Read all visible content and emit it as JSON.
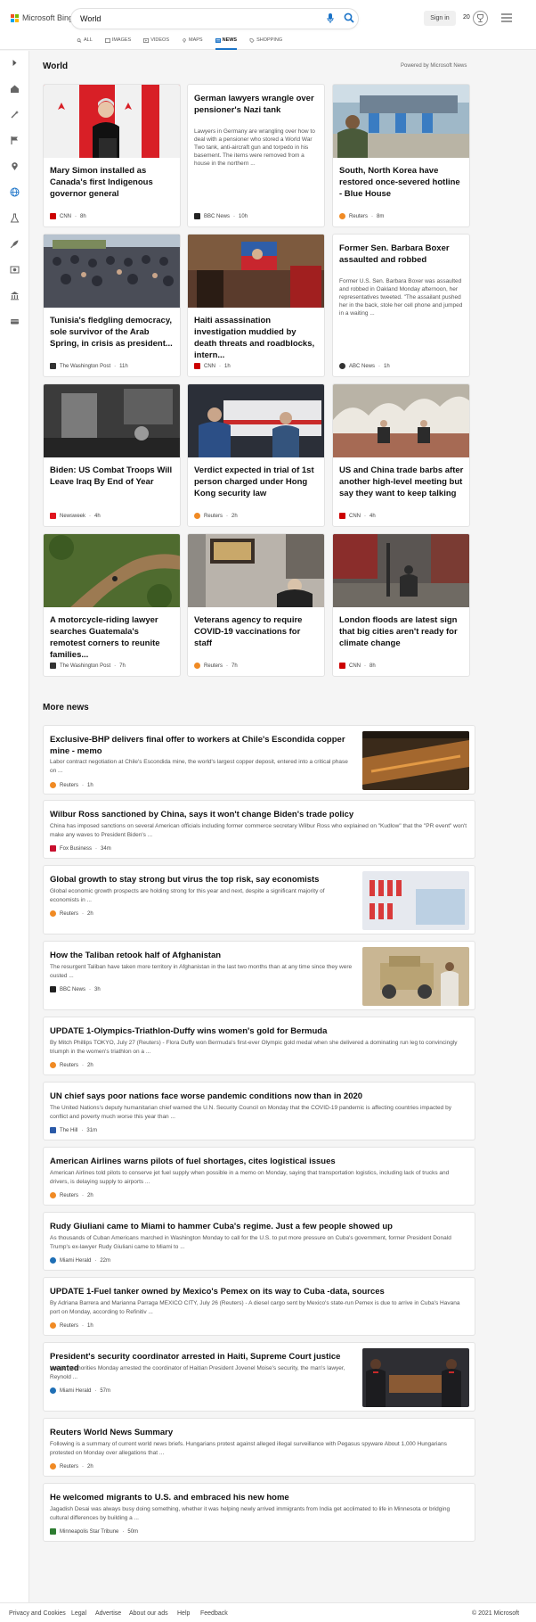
{
  "header": {
    "logo_text": "Microsoft Bing",
    "search_value": "World",
    "signin": "Sign in",
    "rewards_count": "20"
  },
  "tabs": [
    {
      "label": "ALL",
      "icon": "search-icon"
    },
    {
      "label": "IMAGES",
      "icon": "image-icon"
    },
    {
      "label": "VIDEOS",
      "icon": "video-icon"
    },
    {
      "label": "MAPS",
      "icon": "map-pin-icon"
    },
    {
      "label": "NEWS",
      "icon": "news-icon",
      "active": true
    },
    {
      "label": "SHOPPING",
      "icon": "shopping-tag-icon"
    }
  ],
  "rail_icons": [
    "expand-arrow-icon",
    "home-icon",
    "magic-icon",
    "flag-icon",
    "location-icon",
    "globe-icon",
    "science-icon",
    "rocket-icon",
    "entertainment-icon",
    "bank-icon",
    "money-icon"
  ],
  "world": {
    "title": "World",
    "powered": "Powered by Microsoft News",
    "cards": [
      {
        "title": "Mary Simon installed as Canada's first Indigenous governor general",
        "source": "CNN",
        "age": "8h",
        "source_color": "#cc0000"
      },
      {
        "title": "German lawyers wrangle over pensioner's Nazi tank",
        "desc": "Lawyers in Germany are wrangling over how to deal with a pensioner who stored a World War Two tank, anti-aircraft gun and torpedo in his basement. The items were removed from a house in the northern ...",
        "source": "BBC News",
        "age": "10h",
        "source_color": "#222222"
      },
      {
        "title": "South, North Korea have restored once-severed hotline - Blue House",
        "source": "Reuters",
        "age": "8m",
        "source_color": "#f08a24"
      },
      {
        "title": "Tunisia's fledgling democracy, sole survivor of the Arab Spring, in crisis as president...",
        "source": "The Washington Post",
        "age": "11h",
        "source_color": "#333333"
      },
      {
        "title": "Haiti assassination investigation muddied by death threats and roadblocks, intern...",
        "source": "CNN",
        "age": "1h",
        "source_color": "#cc0000"
      },
      {
        "title": "Former Sen. Barbara Boxer assaulted and robbed",
        "desc": "Former U.S. Sen. Barbara Boxer was assaulted and robbed in Oakland Monday afternoon, her representatives tweeted. \"The assailant pushed her in the back, stole her cell phone and jumped in a waiting ...",
        "source": "ABC News",
        "age": "1h",
        "source_color": "#333333"
      },
      {
        "title": "Biden: US Combat Troops Will Leave Iraq By End of Year",
        "source": "Newsweek",
        "age": "4h",
        "source_color": "#e0151f"
      },
      {
        "title": "Verdict expected in trial of 1st person charged under Hong Kong security law",
        "source": "Reuters",
        "age": "2h",
        "source_color": "#f08a24"
      },
      {
        "title": "US and China trade barbs after another high-level meeting but say they want to keep talking",
        "source": "CNN",
        "age": "4h",
        "source_color": "#cc0000"
      },
      {
        "title": "A motorcycle-riding lawyer searches Guatemala's remotest corners to reunite families...",
        "source": "The Washington Post",
        "age": "7h",
        "source_color": "#333333"
      },
      {
        "title": "Veterans agency to require COVID-19 vaccinations for staff",
        "source": "Reuters",
        "age": "7h",
        "source_color": "#f08a24"
      },
      {
        "title": "London floods are latest sign that big cities aren't ready for climate change",
        "source": "CNN",
        "age": "8h",
        "source_color": "#cc0000"
      }
    ]
  },
  "more": {
    "title": "More news",
    "items": [
      {
        "title": "Exclusive-BHP delivers final offer to workers at Chile's Escondida copper mine - memo",
        "desc": "Labor contract negotiation at Chile's Escondida mine, the world's largest copper deposit, entered into a critical phase on ...",
        "source": "Reuters",
        "age": "1h",
        "source_color": "#f08a24"
      },
      {
        "title": "Wilbur Ross sanctioned by China, says it won't change Biden's trade policy",
        "desc": "China has imposed sanctions on several American officials including former commerce secretary Wilbur Ross who explained on \"Kudlow\" that the \"PR event\" won't make any waves to President Biden's ...",
        "source": "Fox Business",
        "age": "34m",
        "source_color": "#c8102e"
      },
      {
        "title": "Global growth to stay strong but virus the top risk, say economists",
        "desc": "Global economic growth prospects are holding strong for this year and next, despite a significant majority of economists in ...",
        "source": "Reuters",
        "age": "2h",
        "source_color": "#f08a24"
      },
      {
        "title": "How the Taliban retook half of Afghanistan",
        "desc": "The resurgent Taliban have taken more territory in Afghanistan in the last two months than at any time since they were ousted ...",
        "source": "BBC News",
        "age": "3h",
        "source_color": "#222222"
      },
      {
        "title": "UPDATE 1-Olympics-Triathlon-Duffy wins women's gold for Bermuda",
        "desc": "By Mitch Phillips TOKYO, July 27 (Reuters) - Flora Duffy won Bermuda's first-ever Olympic gold medal when she delivered a dominating run leg to convincingly triumph in the women's triathlon on a ...",
        "source": "Reuters",
        "age": "2h",
        "source_color": "#f08a24"
      },
      {
        "title": "UN chief says poor nations face worse pandemic conditions now than in 2020",
        "desc": "The United Nations's deputy humanitarian chief warned the U.N. Security Council on Monday that the COVID-19 pandemic is affecting countries impacted by conflict and poverty much worse this year than ...",
        "source": "The Hill",
        "age": "31m",
        "source_color": "#2b5aa8"
      },
      {
        "title": "American Airlines warns pilots of fuel shortages, cites logistical issues",
        "desc": "American Airlines told pilots to conserve jet fuel supply when possible in a memo on Monday, saying that transportation logistics, including lack of trucks and drivers, is delaying supply to airports ...",
        "source": "Reuters",
        "age": "2h",
        "source_color": "#f08a24"
      },
      {
        "title": "Rudy Giuliani came to Miami to hammer Cuba's regime. Just a few people showed up",
        "desc": "As thousands of Cuban Americans marched in Washington Monday to call for the U.S. to put more pressure on Cuba's government, former President Donald Trump's ex-lawyer Rudy Giuliani came to Miami to ...",
        "source": "Miami Herald",
        "age": "22m",
        "source_color": "#1f6fb5"
      },
      {
        "title": "UPDATE 1-Fuel tanker owned by Mexico's Pemex on its way to Cuba -data, sources",
        "desc": "By Adriana Barrera and Marianna Parraga MEXICO CITY, July 26 (Reuters) - A diesel cargo sent by Mexico's state-run Pemex is due to arrive in Cuba's Havana port on Monday, according to Refinitiv ...",
        "source": "Reuters",
        "age": "1h",
        "source_color": "#f08a24"
      },
      {
        "title": "President's security coordinator arrested in Haiti, Supreme Court justice wanted",
        "desc": "Haitian authorities Monday arrested the coordinator of Haitian President Jovenel Moise's security, the man's lawyer, Reynold ...",
        "source": "Miami Herald",
        "age": "57m",
        "source_color": "#1f6fb5"
      },
      {
        "title": "Reuters World News Summary",
        "desc": "Following is a summary of current world news briefs. Hungarians protest against alleged illegal surveillance with Pegasus spyware About 1,000 Hungarians protested on Monday over allegations that ...",
        "source": "Reuters",
        "age": "2h",
        "source_color": "#f08a24"
      },
      {
        "title": "He welcomed migrants to U.S. and embraced his new home",
        "desc": "Jagadish Desai was always busy doing something, whether it was helping newly arrived immigrants from India get acclimated to life in Minnesota or bridging cultural differences by building a ...",
        "source": "Minneapolis Star Tribune",
        "age": "50m",
        "source_color": "#2e7d32"
      }
    ]
  },
  "footer": {
    "links": [
      "Privacy and Cookies",
      "Legal",
      "Advertise",
      "About our ads",
      "Help",
      "Feedback"
    ],
    "copyright": "© 2021 Microsoft"
  }
}
